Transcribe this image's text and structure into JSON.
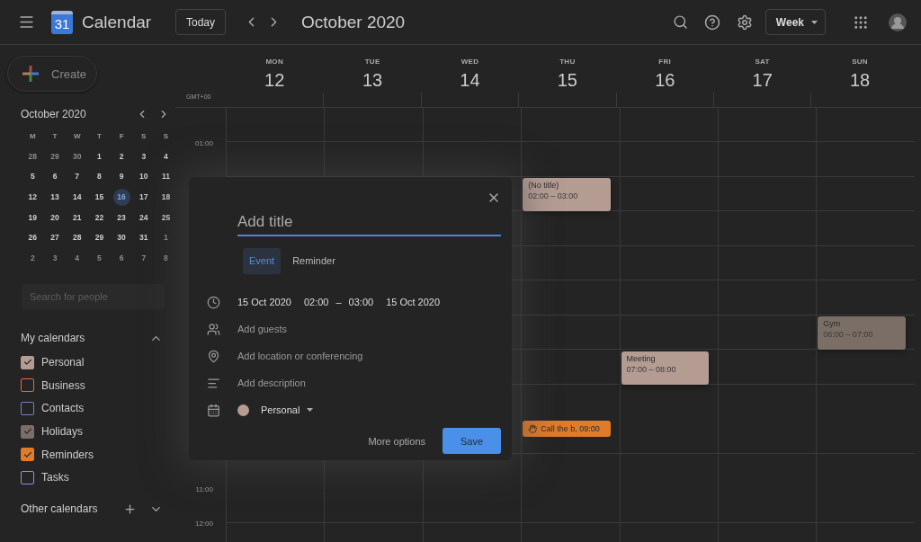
{
  "header": {
    "logo_number": "31",
    "app_name": "Calendar",
    "today_button": "Today",
    "period": "October 2020",
    "view_select": "Week"
  },
  "create_button": "Create",
  "mini_calendar": {
    "title": "October 2020",
    "weekdays": [
      "M",
      "T",
      "W",
      "T",
      "F",
      "S",
      "S"
    ],
    "weeks": [
      [
        {
          "d": "28",
          "outside": true,
          "selected": false
        },
        {
          "d": "29",
          "outside": true,
          "selected": false
        },
        {
          "d": "30",
          "outside": true,
          "selected": false
        },
        {
          "d": "1",
          "outside": false,
          "selected": false
        },
        {
          "d": "2",
          "outside": false,
          "selected": false
        },
        {
          "d": "3",
          "outside": false,
          "selected": false
        },
        {
          "d": "4",
          "outside": false,
          "selected": false
        }
      ],
      [
        {
          "d": "5",
          "outside": false,
          "selected": false
        },
        {
          "d": "6",
          "outside": false,
          "selected": false
        },
        {
          "d": "7",
          "outside": false,
          "selected": false
        },
        {
          "d": "8",
          "outside": false,
          "selected": false
        },
        {
          "d": "9",
          "outside": false,
          "selected": false
        },
        {
          "d": "10",
          "outside": false,
          "selected": false
        },
        {
          "d": "11",
          "outside": false,
          "selected": false
        }
      ],
      [
        {
          "d": "12",
          "outside": false,
          "selected": false
        },
        {
          "d": "13",
          "outside": false,
          "selected": false
        },
        {
          "d": "14",
          "outside": false,
          "selected": false
        },
        {
          "d": "15",
          "outside": false,
          "selected": false
        },
        {
          "d": "16",
          "outside": false,
          "selected": true
        },
        {
          "d": "17",
          "outside": false,
          "selected": false
        },
        {
          "d": "18",
          "outside": false,
          "selected": false
        }
      ],
      [
        {
          "d": "19",
          "outside": false,
          "selected": false
        },
        {
          "d": "20",
          "outside": false,
          "selected": false
        },
        {
          "d": "21",
          "outside": false,
          "selected": false
        },
        {
          "d": "22",
          "outside": false,
          "selected": false
        },
        {
          "d": "23",
          "outside": false,
          "selected": false
        },
        {
          "d": "24",
          "outside": false,
          "selected": false
        },
        {
          "d": "25",
          "outside": false,
          "selected": false
        }
      ],
      [
        {
          "d": "26",
          "outside": false,
          "selected": false
        },
        {
          "d": "27",
          "outside": false,
          "selected": false
        },
        {
          "d": "28",
          "outside": false,
          "selected": false
        },
        {
          "d": "29",
          "outside": false,
          "selected": false
        },
        {
          "d": "30",
          "outside": false,
          "selected": false
        },
        {
          "d": "31",
          "outside": false,
          "selected": false
        },
        {
          "d": "1",
          "outside": true,
          "selected": false
        }
      ],
      [
        {
          "d": "2",
          "outside": true,
          "selected": false
        },
        {
          "d": "3",
          "outside": true,
          "selected": false
        },
        {
          "d": "4",
          "outside": true,
          "selected": false
        },
        {
          "d": "5",
          "outside": true,
          "selected": false
        },
        {
          "d": "6",
          "outside": true,
          "selected": false
        },
        {
          "d": "7",
          "outside": true,
          "selected": false
        },
        {
          "d": "8",
          "outside": true,
          "selected": false
        }
      ]
    ]
  },
  "people_search": {
    "placeholder": "Search for people"
  },
  "my_calendars": {
    "title": "My calendars",
    "expanded": true,
    "items": [
      {
        "name": "Personal",
        "color": "#b49c93",
        "checked": true
      },
      {
        "name": "Business",
        "color": "#e8693e",
        "checked": false
      },
      {
        "name": "Contacts",
        "color": "#7a80c0",
        "checked": false
      },
      {
        "name": "Holidays",
        "color": "#7a6e66",
        "checked": true
      },
      {
        "name": "Reminders",
        "color": "#e07b2a",
        "checked": true
      },
      {
        "name": "Tasks",
        "color": "#8a93e0",
        "checked": false
      }
    ]
  },
  "other_calendars": {
    "title": "Other calendars",
    "expanded": false
  },
  "time_gutter": {
    "zone": "GMT+00",
    "top_labels": [
      "01:00"
    ],
    "bottom_labels": [
      "11:00",
      "12:00"
    ]
  },
  "days": [
    {
      "weekday": "MON",
      "date": "12"
    },
    {
      "weekday": "TUE",
      "date": "13"
    },
    {
      "weekday": "WED",
      "date": "14"
    },
    {
      "weekday": "THU",
      "date": "15",
      "events": [
        {
          "kind": "event",
          "title": "(No title)",
          "time": "02:00 – 03:00",
          "color": "#b49c93"
        },
        {
          "kind": "reminder",
          "title": "Call the b, 09:00",
          "color": "#e07b2a"
        }
      ]
    },
    {
      "weekday": "FRI",
      "date": "16",
      "events": [
        {
          "kind": "event",
          "title": "Meeting",
          "time": "07:00 – 08:00",
          "color": "#b49c93"
        }
      ]
    },
    {
      "weekday": "SAT",
      "date": "17"
    },
    {
      "weekday": "SUN",
      "date": "18",
      "events": [
        {
          "kind": "event",
          "title": "Gym",
          "time": "06:00 – 07:00",
          "color": "#7a6e66"
        }
      ]
    }
  ],
  "dialog": {
    "title_placeholder": "Add title",
    "tabs": [
      {
        "label": "Event",
        "selected": true
      },
      {
        "label": "Reminder",
        "selected": false
      }
    ],
    "start_date": "15 Oct 2020",
    "start_time": "02:00",
    "dash": "–",
    "end_time": "03:00",
    "end_date": "15 Oct 2020",
    "guests": "Add guests",
    "location": "Add location or conferencing",
    "description": "Add description",
    "calendar": {
      "name": "Personal",
      "color": "#b49c93"
    },
    "more_options": "More options",
    "save": "Save"
  }
}
